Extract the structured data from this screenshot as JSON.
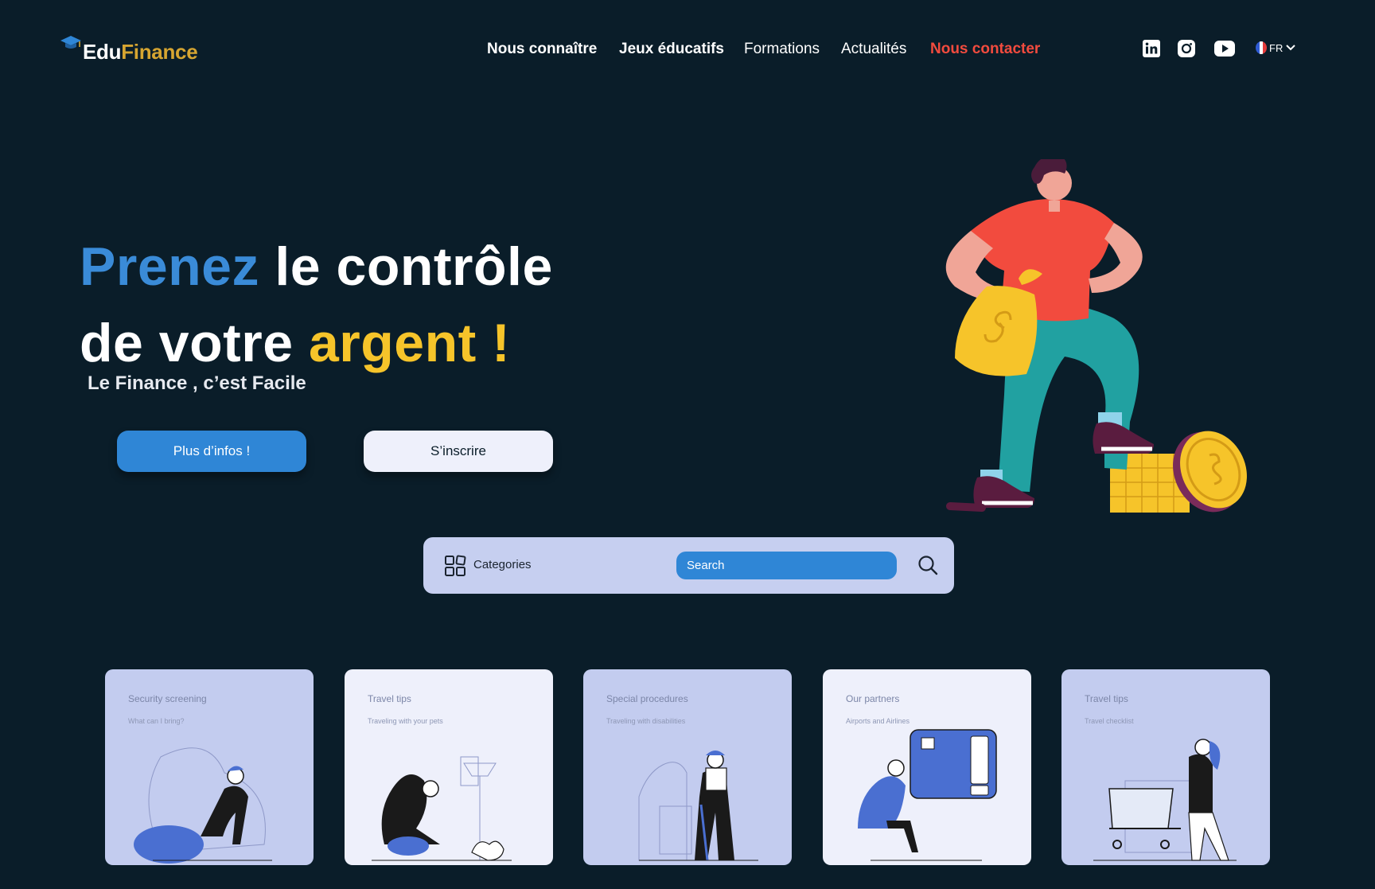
{
  "brand": {
    "part1": "Edu",
    "part2": "Finance"
  },
  "nav": {
    "items": [
      {
        "label": "Nous connaître"
      },
      {
        "label": "Jeux éducatifs"
      },
      {
        "label": "Formations"
      },
      {
        "label": "Actualités"
      },
      {
        "label": "Nous contacter"
      }
    ]
  },
  "social": {
    "icons": [
      "linkedin-icon",
      "instagram-icon",
      "youtube-icon"
    ]
  },
  "language": {
    "code": "FR"
  },
  "hero": {
    "line1_highlight": "Prenez",
    "line1_rest": "le contrôle",
    "line2_start": "de votre",
    "line2_highlight": "argent !",
    "subtitle": "Le Finance , c’est Facile",
    "primary_button": "Plus d’infos !",
    "secondary_button": "S’inscrire"
  },
  "search": {
    "categories_label": "Categories",
    "placeholder": "Search"
  },
  "cards": [
    {
      "title": "Security screening",
      "subtitle": "What can I bring?"
    },
    {
      "title": "Travel tips",
      "subtitle": "Traveling with your pets"
    },
    {
      "title": "Special procedures",
      "subtitle": "Traveling with disabilities"
    },
    {
      "title": "Our partners",
      "subtitle": "Airports and Airlines"
    },
    {
      "title": "Travel tips",
      "subtitle": "Travel checklist"
    }
  ],
  "colors": {
    "background": "#0a1d29",
    "accent_blue": "#3a8bd8",
    "accent_yellow": "#f6c42a",
    "accent_red": "#f24b3e",
    "brand_gold": "#d6a531",
    "search_bg": "#c6cff0"
  }
}
